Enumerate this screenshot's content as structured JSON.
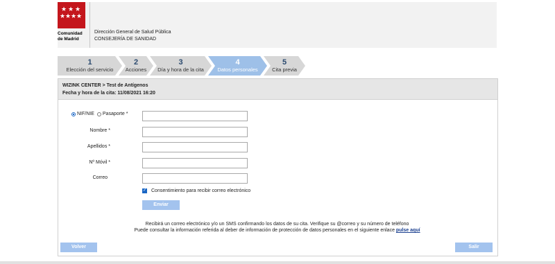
{
  "header": {
    "logo_line1": "Comunidad",
    "logo_line2": "de Madrid",
    "agency_line1": "Dirección General de Salud Pública",
    "agency_line2": "CONSEJERÍA DE SANIDAD",
    "brand_color": "#c4161c"
  },
  "steps": [
    {
      "num": "1",
      "label": "Elección del servicio",
      "active": false
    },
    {
      "num": "2",
      "label": "Acciones",
      "active": false
    },
    {
      "num": "3",
      "label": "Día y hora de la cita",
      "active": false
    },
    {
      "num": "4",
      "label": "Datos personales",
      "active": true
    },
    {
      "num": "5",
      "label": "Cita previa",
      "active": false
    }
  ],
  "appointment": {
    "location": "WIZINK CENTER > Test de Antígenos",
    "datetime": "Fecha y hora de la cita: 11/08/2021 16:20"
  },
  "form": {
    "id_option_nif": "NIF/NIE",
    "id_option_passport": "Pasaporte *",
    "nombre_label": "Nombre *",
    "apellidos_label": "Apellidos *",
    "movil_label": "Nº Móvil *",
    "correo_label": "Correo",
    "consent_label": "Consentimiento para recibir correo electrónico",
    "submit_label": "Enviar"
  },
  "info": {
    "line1": "Recibirá un correo electrónico y/o un SMS confirmando los datos de su cita. Verifique su @correo y su número de teléfono",
    "line2": "Puede consultar la información referida al deber de información de protección de datos personales en el siguiente enlace",
    "link": "pulse aquí"
  },
  "nav": {
    "back_label": "Volver",
    "exit_label": "Salir"
  },
  "colors": {
    "accent": "#9ec0e8",
    "button": "#a3c3ee"
  }
}
